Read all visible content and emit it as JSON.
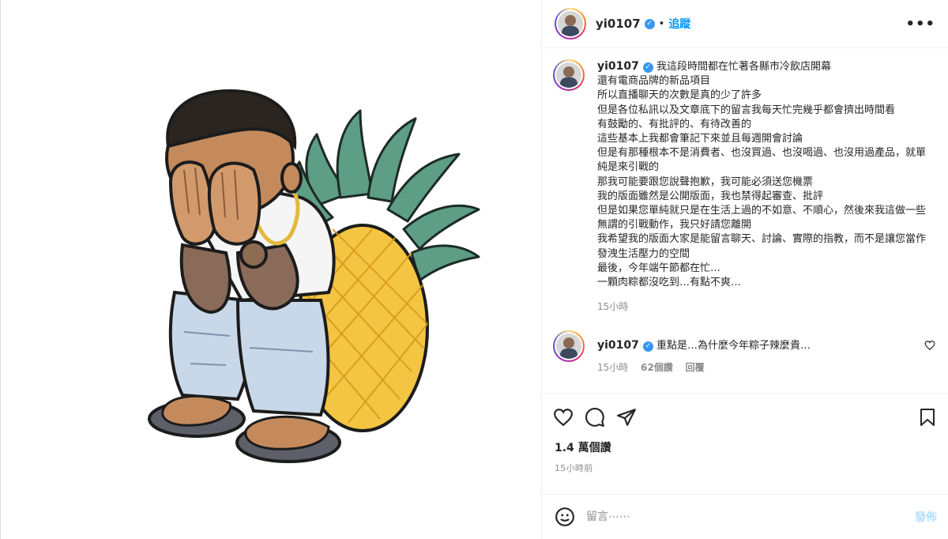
{
  "post": {
    "username": "yi0107",
    "verified": true,
    "dot": "•",
    "follow_label": "追蹤",
    "more_label": "•••"
  },
  "caption": {
    "username": "yi0107",
    "lines": [
      "我這段時間都在忙著各縣市冷飲店開幕",
      "還有電商品牌的新品項目",
      "所以直播聊天的次數是真的少了許多",
      "但是各位私訊以及文章底下的留言我每天忙完幾乎都會擠出時間看",
      "有鼓勵的、有批評的、有待改善的",
      "這些基本上我都會筆記下來並且每週開會討論",
      "但是有那種根本不是消費者、也沒買過、也沒喝過、也沒用過產品，就單純是來引戰的",
      "那我可能要跟您說聲抱歉，我可能必須送您機票",
      "我的版面雖然是公開版面，我也禁得起審查、批評",
      "但是如果您單純就只是在生活上過的不如意、不順心，然後來我這做一些無謂的引戰動作，我只好請您離開",
      "我希望我的版面大家是能留言聊天、討論、實際的指教，而不是讓您當作發洩生活壓力的空間",
      "最後，今年端午節都在忙…",
      "一顆肉粽都沒吃到…有點不爽…"
    ],
    "time": "15小時"
  },
  "comment": {
    "username": "yi0107",
    "text": "重點是…為什麼今年粽子辣麼貴…",
    "time": "15小時",
    "likes": "62個讚",
    "reply_label": "回覆"
  },
  "actions": {
    "icons": [
      "heart-icon",
      "comment-icon",
      "share-icon",
      "save-icon"
    ],
    "likes_count": "1.4 萬個讚",
    "posted_ago": "15小時前"
  },
  "add_comment": {
    "placeholder": "留言⋯⋯",
    "post_label": "發佈",
    "emoji_icon": "smiley-icon"
  },
  "colors": {
    "link_blue": "#0095f6",
    "post_disabled": "#b2dffc",
    "verified": "#3897f0",
    "pineapple": "#f4c542",
    "leaves": "#4e8f7a"
  }
}
